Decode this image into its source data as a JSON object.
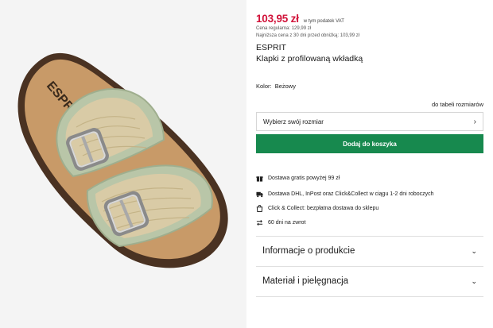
{
  "product": {
    "price": "103,95 zł",
    "vat_note": "w tym podatek VAT",
    "regular_price_label": "Cena regularna:",
    "regular_price": "129,99 zł",
    "lowest_price_label": "Najniższa cena z 30 dni przed obniżką:",
    "lowest_price": "103,99 zł",
    "brand": "ESPRIT",
    "name": "Klapki z profilowaną wkładką",
    "color_label": "Kolor:",
    "color_value": "Beżowy",
    "image_logo_text": "ESPRIT"
  },
  "size": {
    "chart_link": "do tabeli rozmiarów",
    "placeholder": "Wybierz swój rozmiar"
  },
  "cart": {
    "add_label": "Dodaj do koszyka",
    "button_color": "#17894e"
  },
  "benefits": [
    {
      "icon": "gift-icon",
      "text": "Dostawa gratis powyżej 99 zł"
    },
    {
      "icon": "truck-icon",
      "text": "Dostawa DHL, InPost oraz Click&Collect w ciągu 1-2 dni roboczych"
    },
    {
      "icon": "store-bag-icon",
      "text": "Click & Collect: bezpłatna dostawa do sklepu"
    },
    {
      "icon": "return-arrows-icon",
      "text": "60 dni na zwrot"
    }
  ],
  "accordions": [
    {
      "label": "Informacje o produkcie"
    },
    {
      "label": "Materiał i pielęgnacja"
    }
  ],
  "colors": {
    "price": "#d1133a",
    "image_bg": "#f4f4f4"
  }
}
